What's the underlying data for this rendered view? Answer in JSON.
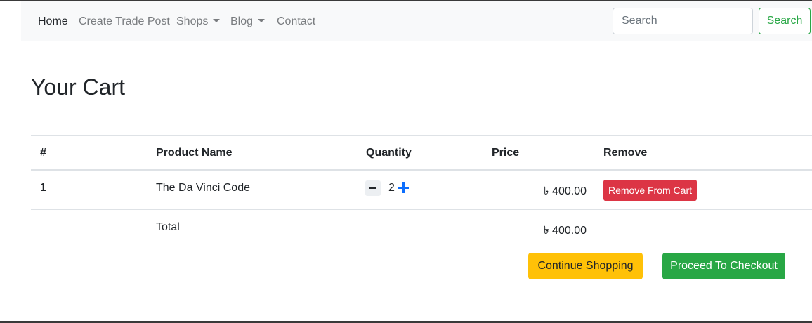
{
  "nav": {
    "items": [
      {
        "label": "Home",
        "active": true,
        "dropdown": false
      },
      {
        "label": "Create Trade Post",
        "active": false,
        "dropdown": false
      },
      {
        "label": "Shops",
        "active": false,
        "dropdown": true
      },
      {
        "label": "Blog",
        "active": false,
        "dropdown": true
      },
      {
        "label": "Contact",
        "active": false,
        "dropdown": false
      }
    ],
    "search": {
      "placeholder": "Search",
      "button_label": "Search"
    }
  },
  "page": {
    "title": "Your Cart"
  },
  "cart": {
    "headers": [
      "#",
      "Product Name",
      "Quantity",
      "Price",
      "Remove"
    ],
    "rows": [
      {
        "index": "1",
        "product": "The Da Vinci Code",
        "quantity": "2",
        "price": "৳ 400.00",
        "remove_label": "Remove From Cart"
      }
    ],
    "total_label": "Total",
    "total_value": "৳ 400.00"
  },
  "actions": {
    "continue_label": "Continue Shopping",
    "checkout_label": "Proceed To Checkout"
  },
  "colors": {
    "success": "#28a745",
    "danger": "#dc3545",
    "warning": "#ffc107",
    "primary": "#0d6efd",
    "navbar_bg": "#f8f9fa"
  }
}
